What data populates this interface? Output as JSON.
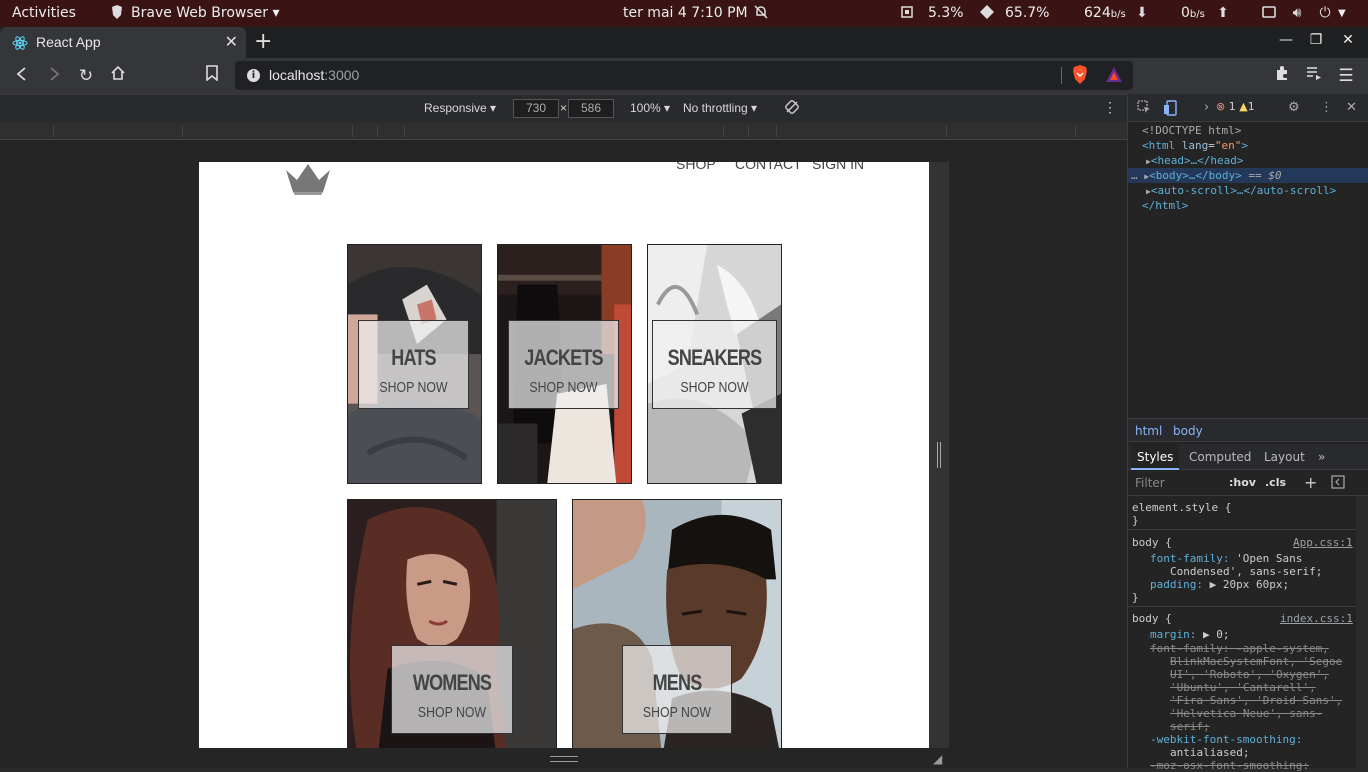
{
  "system_bar": {
    "activities": "Activities",
    "app_name": "Brave Web Browser",
    "datetime": "ter mai 4   7:10 PM",
    "cpu": "5.3%",
    "mem": "65.7%",
    "net_down": "624",
    "net_down_unit": "b/s",
    "net_up": "0",
    "net_up_unit": "b/s"
  },
  "browser": {
    "tab_title": "React App",
    "url_host": "localhost",
    "url_port": ":3000"
  },
  "device_toolbar": {
    "mode": "Responsive",
    "width": "730",
    "height": "586",
    "times": "×",
    "zoom": "100%",
    "throttle": "No throttling"
  },
  "page": {
    "nav": [
      "SHOP",
      "CONTACT",
      "SIGN IN"
    ],
    "categories": [
      {
        "title": "HATS",
        "subtitle": "SHOP NOW"
      },
      {
        "title": "JACKETS",
        "subtitle": "SHOP NOW"
      },
      {
        "title": "SNEAKERS",
        "subtitle": "SHOP NOW"
      },
      {
        "title": "WOMENS",
        "subtitle": "SHOP NOW"
      },
      {
        "title": "MENS",
        "subtitle": "SHOP NOW"
      }
    ]
  },
  "devtools": {
    "errors": "1",
    "warnings": "1",
    "dom": {
      "doctype": "<!DOCTYPE html>",
      "html_open_tag": "<html",
      "html_attr": "lang",
      "html_attr_val": "\"en\"",
      "head": "<head>…</head>",
      "body": "<body>…</body>",
      "body_ref": "== $0",
      "autoscroll": "<auto-scroll>…</auto-scroll>",
      "html_close": "</html>"
    },
    "crumbs": [
      "html",
      "body"
    ],
    "tabs": [
      "Styles",
      "Computed",
      "Layout",
      "»"
    ],
    "filter_placeholder": "Filter",
    "hov": ":hov",
    "cls": ".cls",
    "styles": {
      "element_style": "element.style {",
      "close": "}",
      "rule1_selector": "body {",
      "rule1_source": "App.css:1",
      "rule1_ff_prop": "font-family:",
      "rule1_ff_val1": "'Open Sans",
      "rule1_ff_val2": "Condensed', sans-serif;",
      "rule1_pad_prop": "padding:",
      "rule1_pad_val": "▶ 20px 60px;",
      "rule2_selector": "body {",
      "rule2_source": "index.css:1",
      "rule2_margin_prop": "margin:",
      "rule2_margin_val": "▶ 0;",
      "rule2_ff_lines": [
        "font-family: -apple-system,",
        "BlinkMacSystemFont, 'Segoe",
        "UI', 'Roboto', 'Oxygen',",
        "'Ubuntu', 'Cantarell',",
        "'Fira Sans', 'Droid Sans',",
        "'Helvetica Neue', sans-",
        "serif;"
      ],
      "rule2_smooth_prop": "-webkit-font-smoothing:",
      "rule2_smooth_val": "antialiased;",
      "rule2_moz": "-moz-osx-font-smoothing:"
    }
  }
}
